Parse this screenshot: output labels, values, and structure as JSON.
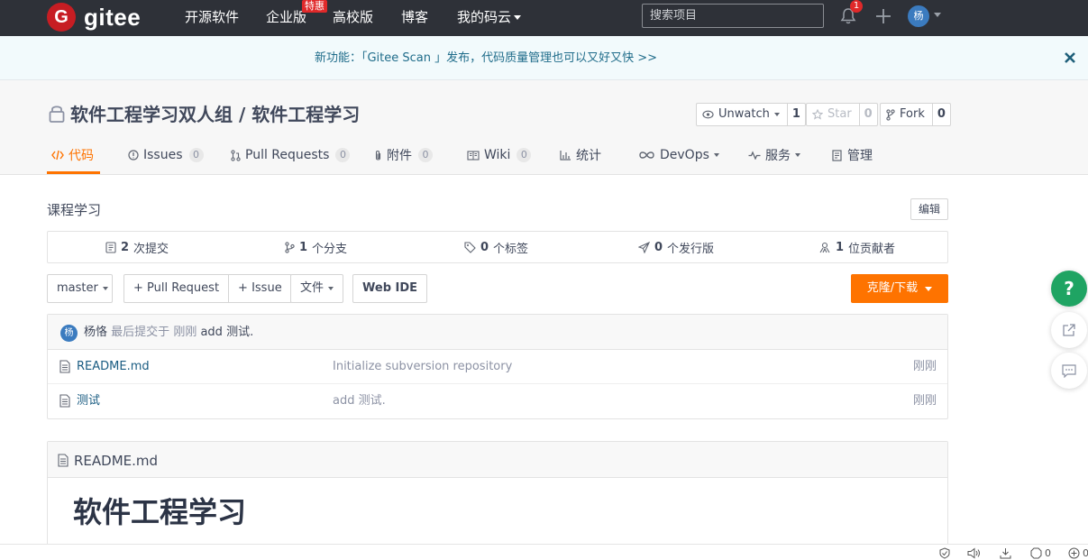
{
  "nav": {
    "logo_text": "gitee",
    "logo_mark": "G",
    "items": [
      "开源软件",
      "企业版",
      "高校版",
      "博客",
      "我的码云"
    ],
    "hot_badge": "特惠",
    "search_placeholder": "搜索项目",
    "notification_count": "1",
    "avatar_letter": "杨",
    "brand_color": "#c71d23"
  },
  "notice": {
    "text": "新功能：「Gitee Scan 」发布，代码质量管理也可以又好又快 >>"
  },
  "repo": {
    "title": "软件工程学习双人组 / 软件工程学习",
    "watch_label": "Unwatch",
    "watch_count": "1",
    "star_label": "Star",
    "star_count": "0",
    "fork_label": "Fork",
    "fork_count": "0"
  },
  "tabs": [
    {
      "label": "代码"
    },
    {
      "label": "Issues",
      "count": "0"
    },
    {
      "label": "Pull Requests",
      "count": "0"
    },
    {
      "label": "附件",
      "count": "0"
    },
    {
      "label": "Wiki",
      "count": "0"
    },
    {
      "label": "统计"
    },
    {
      "label": "DevOps"
    },
    {
      "label": "服务"
    },
    {
      "label": "管理"
    }
  ],
  "description": "课程学习",
  "edit_label": "编辑",
  "stats": [
    {
      "num": "2",
      "label": "次提交"
    },
    {
      "num": "1",
      "label": "个分支"
    },
    {
      "num": "0",
      "label": "个标签"
    },
    {
      "num": "0",
      "label": "个发行版"
    },
    {
      "num": "1",
      "label": "位贡献者"
    }
  ],
  "toolbar": {
    "branch": "master",
    "pull_request": "+ Pull Request",
    "issue": "+ Issue",
    "file": "文件",
    "web_ide": "Web IDE",
    "clone": "克隆/下载"
  },
  "last_commit": {
    "avatar_letter": "杨",
    "author": "杨恪",
    "prefix": "最后提交于",
    "time": "刚刚",
    "message": "add 测试."
  },
  "files": [
    {
      "name": "README.md",
      "message": "Initialize subversion repository",
      "time": "刚刚"
    },
    {
      "name": "测试",
      "message": "add 测试.",
      "time": "刚刚"
    }
  ],
  "readme": {
    "filename": "README.md",
    "heading": "软件工程学习"
  },
  "float": {
    "help": "?"
  },
  "statusbar": {
    "count_a": "0",
    "count_b": "0"
  },
  "colors": {
    "accent": "#fe7300",
    "nav_bg": "#2e3138",
    "help_green": "#1fa463"
  }
}
